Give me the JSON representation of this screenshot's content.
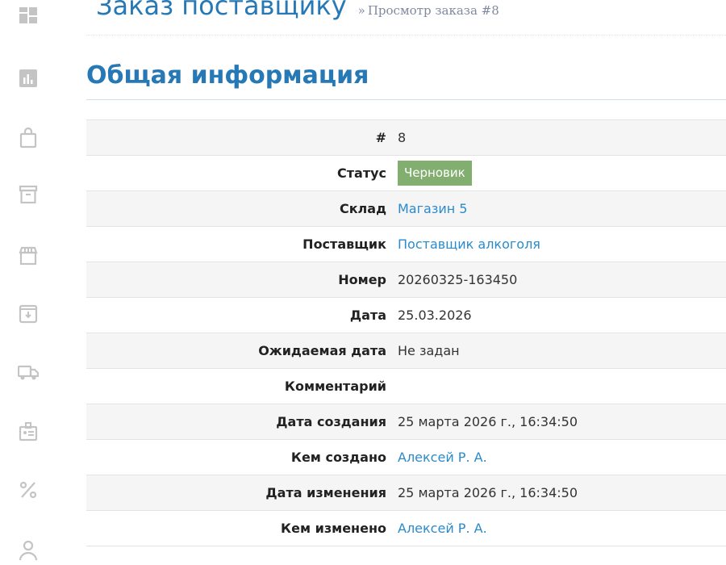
{
  "header": {
    "title": "Заказ поставщику",
    "subtitle_prefix": "»",
    "subtitle": "Просмотр заказа #8"
  },
  "section": {
    "title": "Общая информация"
  },
  "sidebar": {
    "items": [
      {
        "icon": "dashboard-icon"
      },
      {
        "icon": "chart-icon"
      },
      {
        "icon": "shopping-bag-icon"
      },
      {
        "icon": "archive-icon"
      },
      {
        "icon": "store-icon"
      },
      {
        "icon": "download-box-icon"
      },
      {
        "icon": "truck-icon"
      },
      {
        "icon": "id-card-icon"
      },
      {
        "icon": "percent-icon"
      },
      {
        "icon": "user-icon"
      }
    ]
  },
  "info": {
    "number_label": "#",
    "number_value": "8",
    "status_label": "Статус",
    "status_value": "Черновик",
    "warehouse_label": "Склад",
    "warehouse_value": "Магазин 5",
    "supplier_label": "Поставщик",
    "supplier_value": "Поставщик алкоголя",
    "doc_number_label": "Номер",
    "doc_number_value": "20260325-163450",
    "date_label": "Дата",
    "date_value": "25.03.2026",
    "expected_date_label": "Ожидаемая дата",
    "expected_date_value": "Не задан",
    "comment_label": "Комментарий",
    "comment_value": "",
    "created_at_label": "Дата создания",
    "created_at_value": "25 марта 2026 г., 16:34:50",
    "created_by_label": "Кем создано",
    "created_by_value": "Алексей Р. А.",
    "updated_at_label": "Дата изменения",
    "updated_at_value": "25 марта 2026 г., 16:34:50",
    "updated_by_label": "Кем изменено",
    "updated_by_value": "Алексей Р. А."
  },
  "colors": {
    "title_blue": "#2679b5",
    "link_blue": "#2a8bcc",
    "badge_green": "#82af6f",
    "icon_gray": "#c4c4c4"
  }
}
